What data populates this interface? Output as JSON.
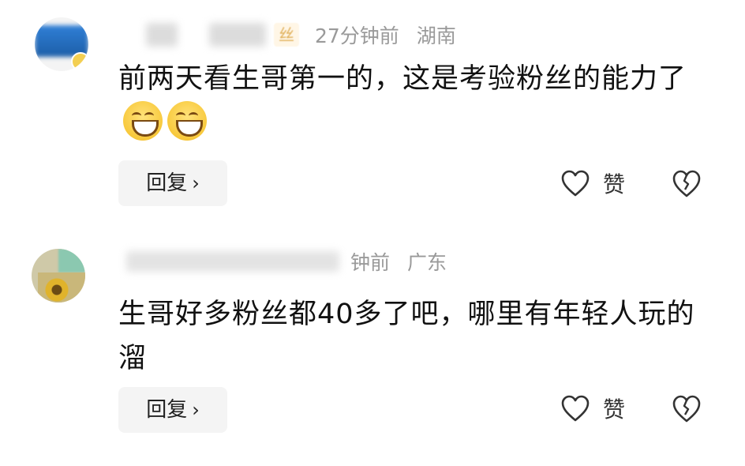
{
  "comments": [
    {
      "fan_badge": "丝",
      "time": "27分钟前",
      "location": "湖南",
      "text": "前两天看生哥第一的，这是考验粉丝的能力了",
      "emojis": [
        "laughing-emoji",
        "laughing-emoji"
      ],
      "reply_label": "回复",
      "like_label": "赞"
    },
    {
      "time": "钟前",
      "location": "广东",
      "text": "生哥好多粉丝都40多了吧，哪里有年轻人玩的溜",
      "reply_label": "回复",
      "like_label": "赞"
    }
  ],
  "icons": {
    "reply_chevron": "chevron-right-icon",
    "like": "heart-outline-icon",
    "dislike": "broken-heart-icon"
  }
}
